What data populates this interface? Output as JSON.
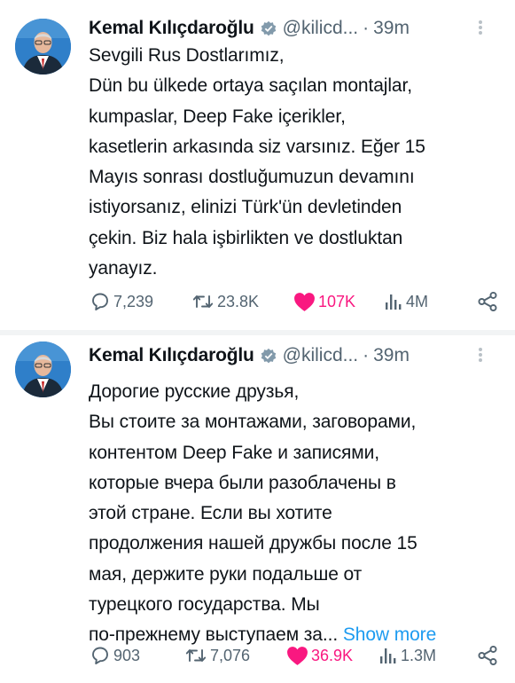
{
  "tweets": [
    {
      "author": "Kemal Kılıçdaroğlu",
      "handle": "@kilicd...",
      "separator": "·",
      "time": "39m",
      "lines": [
        "Sevgili Rus Dostlarımız,",
        "Dün bu ülkede ortaya saçılan montajlar,",
        "kumpaslar, Deep Fake içerikler,",
        "kasetlerin arkasında siz varsınız. Eğer 15",
        "Mayıs sonrası dostluğumuzun devamını",
        "istiyorsanız, elinizi Türk'ün devletinden",
        "çekin. Biz hala işbirlikten ve dostluktan",
        "yanayız."
      ],
      "replies": "7,239",
      "retweets": "23.8K",
      "likes": "107K",
      "views": "4M"
    },
    {
      "author": "Kemal Kılıçdaroğlu",
      "handle": "@kilicd...",
      "separator": "·",
      "time": "39m",
      "lines": [
        "Дорогие русские друзья,",
        "Вы стоите за монтажами, заговорами,",
        "контентом Deep Fake и записями,",
        "которые вчера были разоблачены в",
        "этой стране. Если вы хотите",
        "продолжения нашей дружбы после 15",
        "мая, держите руки подальше от",
        "турецкого государства. Мы",
        "по-прежнему выступаем за..."
      ],
      "show_more": "Show more",
      "replies": "903",
      "retweets": "7,076",
      "likes": "36.9K",
      "views": "1.3M"
    }
  ],
  "icons": {
    "verified": "verified-badge-icon",
    "more": "more-options-icon",
    "reply": "reply-icon",
    "retweet": "retweet-icon",
    "like": "heart-icon",
    "views": "views-icon",
    "share": "share-icon"
  },
  "colors": {
    "text": "#0f1419",
    "secondary": "#536471",
    "link": "#1d9bf0",
    "like": "#f91880",
    "avatar_bg": "#2f7fc9"
  }
}
